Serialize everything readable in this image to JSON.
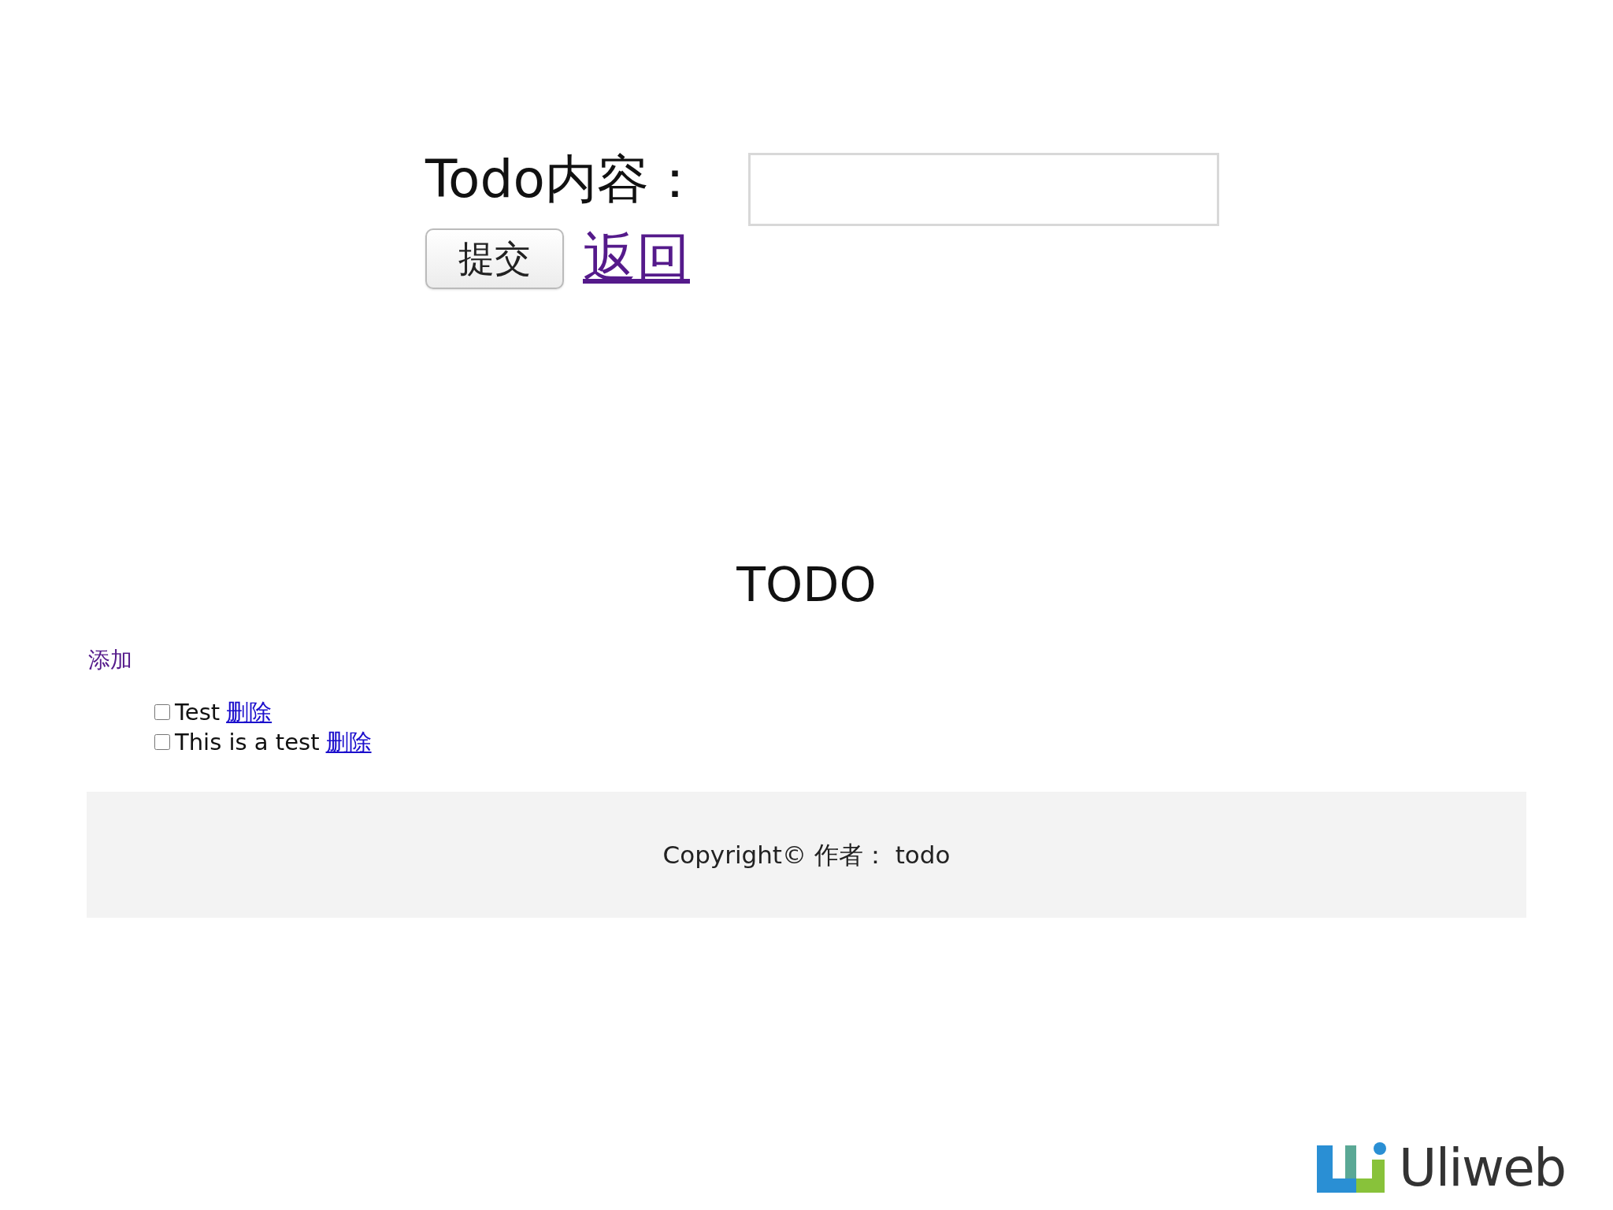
{
  "form": {
    "label": "Todo内容：",
    "submit": "提交",
    "back": "返回"
  },
  "heading": "TODO",
  "add_link": "添加",
  "todos": [
    {
      "text": "Test",
      "checked": false,
      "delete": "删除"
    },
    {
      "text": "This is a test",
      "checked": false,
      "delete": "删除"
    }
  ],
  "footer": "Copyright© 作者： todo",
  "logo": "Uliweb"
}
